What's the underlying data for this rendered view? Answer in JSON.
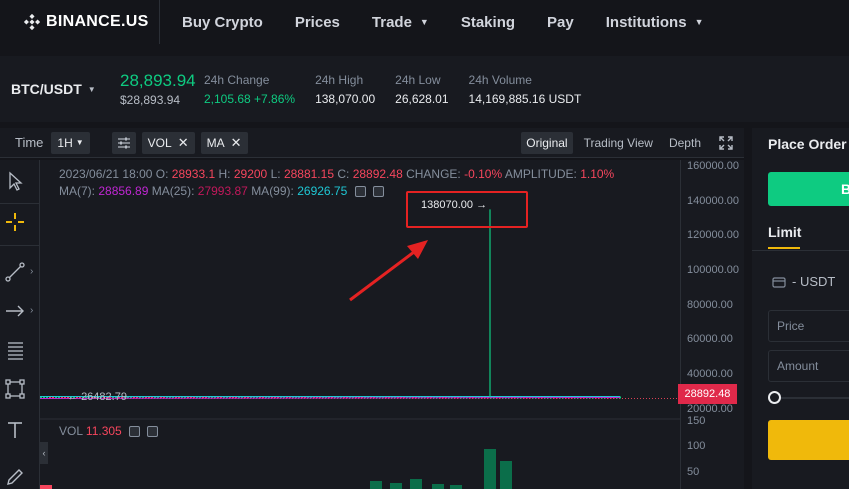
{
  "nav": {
    "logo_text": "BINANCE.US",
    "items": [
      {
        "label": "Buy Crypto",
        "has_caret": false
      },
      {
        "label": "Prices",
        "has_caret": false
      },
      {
        "label": "Trade",
        "has_caret": true
      },
      {
        "label": "Staking",
        "has_caret": false
      },
      {
        "label": "Pay",
        "has_caret": false
      },
      {
        "label": "Institutions",
        "has_caret": true
      }
    ]
  },
  "ticker": {
    "pair": "BTC/USDT",
    "last_price": "28,893.94",
    "last_price_usd": "$28,893.94",
    "change_label": "24h Change",
    "change_value": "2,105.68 +7.86%",
    "high_label": "24h High",
    "high_value": "138,070.00",
    "low_label": "24h Low",
    "low_value": "26,628.01",
    "volume_label": "24h Volume",
    "volume_value": "14,169,885.16 USDT"
  },
  "toolbar": {
    "time_label": "Time",
    "interval": "1H",
    "vol_tag": "VOL",
    "ma_tag": "MA",
    "views": [
      "Original",
      "Trading View",
      "Depth"
    ],
    "active_view": "Original"
  },
  "legend": {
    "datetime": "2023/06/21 18:00",
    "o_label": "O:",
    "o_value": "28933.1",
    "h_label": "H:",
    "h_value": "29200",
    "l_label": "L:",
    "l_value": "28881.15",
    "c_label": "C:",
    "c_value": "28892.48",
    "change_label": "CHANGE:",
    "change_value": "-0.10%",
    "amplitude_label": "AMPLITUDE:",
    "amplitude_value": "1.10%",
    "ma7_label": "MA(7):",
    "ma7_value": "28856.89",
    "ma25_label": "MA(25):",
    "ma25_value": "27993.87",
    "ma99_label": "MA(99):",
    "ma99_value": "26926.75",
    "vol_label": "VOL",
    "vol_value": "11.305"
  },
  "chart_data": {
    "type": "candlestick",
    "y_axis_ticks": [
      "160000.00",
      "140000.00",
      "120000.00",
      "100000.00",
      "80000.00",
      "60000.00",
      "40000.00",
      "20000.00"
    ],
    "ylim": [
      20000,
      160000
    ],
    "volume_ticks": [
      "150",
      "100",
      "50"
    ],
    "marked_high": "138070.00",
    "marked_low": "26482.79",
    "current_price_tag": "28892.48",
    "spike_wick_high": 138070.0,
    "baseline_price": 28892.48
  },
  "order_panel": {
    "title": "Place Order",
    "buy_button_text": "B",
    "order_type": "Limit",
    "available": "- USDT",
    "price_placeholder": "Price",
    "amount_placeholder": "Amount",
    "slider_value_percent": 0
  },
  "colors": {
    "up": "#0ecb81",
    "down": "#f6465d",
    "accent": "#f0b90b",
    "annotation": "#e42222"
  }
}
